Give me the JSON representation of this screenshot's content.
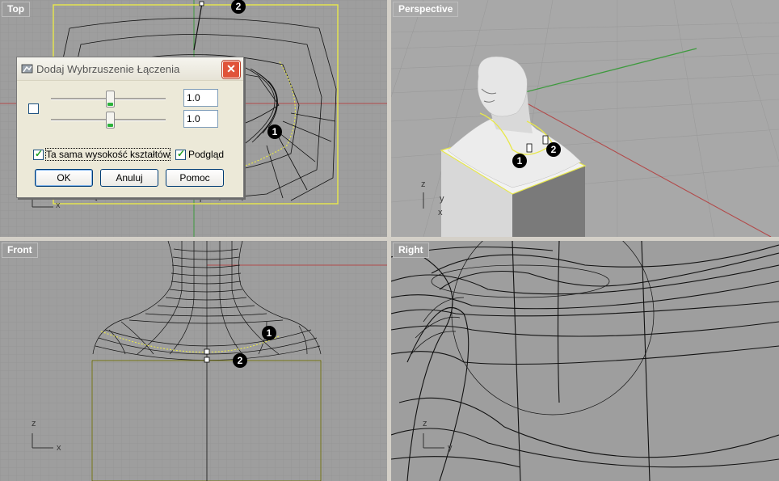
{
  "viewports": {
    "top": {
      "label": "Top",
      "axis_x": "x",
      "marker1": "1",
      "marker2": "2"
    },
    "perspective": {
      "label": "Perspective",
      "axis_x": "x",
      "axis_y": "y",
      "axis_z": "z",
      "marker1": "1",
      "marker2": "2"
    },
    "front": {
      "label": "Front",
      "axis_x": "x",
      "axis_z": "z",
      "marker1": "1",
      "marker2": "2"
    },
    "right": {
      "label": "Right",
      "axis_y": "y",
      "axis_z": "z"
    }
  },
  "dialog": {
    "title": "Dodaj Wybrzuszenie Łączenia",
    "close": "✕",
    "slider1_value": "1.0",
    "slider2_value": "1.0",
    "same_height_label": "Ta sama wysokość kształtów",
    "preview_label": "Podgląd",
    "ok": "OK",
    "cancel": "Anuluj",
    "help": "Pomoc"
  },
  "colors": {
    "viewport_bg": "#9e9e9e",
    "grid": "#8f8f8f",
    "x_axis": "#b24a4a",
    "y_axis": "#3e9a3e",
    "highlight": "#e8e84a"
  }
}
